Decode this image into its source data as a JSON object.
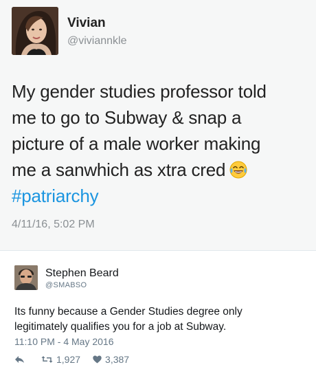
{
  "tweet": {
    "author_name": "Vivian",
    "author_handle": "@viviannkle",
    "text_lines": [
      "My gender studies professor told",
      "me to go to Subway & snap a",
      "picture of a male worker making",
      "me a sanwhich as xtra cred"
    ],
    "emoji": "laughing-crying-emoji",
    "hashtag": "#patriarchy",
    "timestamp": "4/11/16, 5:02 PM"
  },
  "reply": {
    "author_name": "Stephen Beard",
    "author_handle": "@SMABSO",
    "text_lines": [
      "Its funny because a Gender Studies degree only",
      "legitimately qualifies you for a job at Subway."
    ],
    "timestamp": "11:10 PM - 4 May 2016",
    "retweet_count": "1,927",
    "like_count": "3,387"
  },
  "colors": {
    "hashtag": "#1b95e0",
    "muted": "#8a8f93",
    "tweet_bg": "#f6f7f7"
  }
}
